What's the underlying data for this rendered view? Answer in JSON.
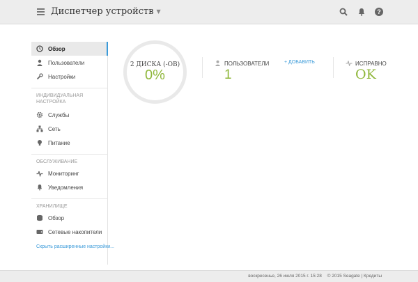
{
  "header": {
    "title": "Диспетчер устройств",
    "icons": [
      "search-icon",
      "bell-icon",
      "help-icon"
    ]
  },
  "sidebar": {
    "items": [
      {
        "label": "Обзор",
        "icon": "clock-icon",
        "active": true
      },
      {
        "label": "Пользователи",
        "icon": "user-icon"
      },
      {
        "label": "Настройки",
        "icon": "wrench-icon"
      }
    ],
    "section_custom": "Индивидуальная настройка",
    "custom_items": [
      {
        "label": "Службы",
        "icon": "gear-icon"
      },
      {
        "label": "Сеть",
        "icon": "network-icon"
      },
      {
        "label": "Питание",
        "icon": "bulb-icon"
      }
    ],
    "section_service": "Обслуживание",
    "service_items": [
      {
        "label": "Мониторинг",
        "icon": "pulse-icon"
      },
      {
        "label": "Уведомления",
        "icon": "bell-icon"
      }
    ],
    "section_storage": "Хранилище",
    "storage_items": [
      {
        "label": "Обзор",
        "icon": "disk-icon"
      },
      {
        "label": "Сетевые накопители",
        "icon": "drive-icon"
      }
    ],
    "link": "Скрыть расширенные настройки..."
  },
  "main": {
    "disks_label": "2 ДИСКА (-ОВ)",
    "disks_value": "0%",
    "users_label": "ПОЛЬЗОВАТЕЛИ",
    "users_add": "+ ДОБАВИТЬ",
    "users_value": "1",
    "health_label": "ИСПРАВНО",
    "health_value": "OK"
  },
  "footer": {
    "datetime": "воскресенье, 26 июля 2015 г.   15:28",
    "copyright": "© 2015 Seagate",
    "sep": "|",
    "credits": "Кредиты"
  },
  "colors": {
    "accent": "#3a9ad9",
    "ok": "#8fb73a"
  }
}
